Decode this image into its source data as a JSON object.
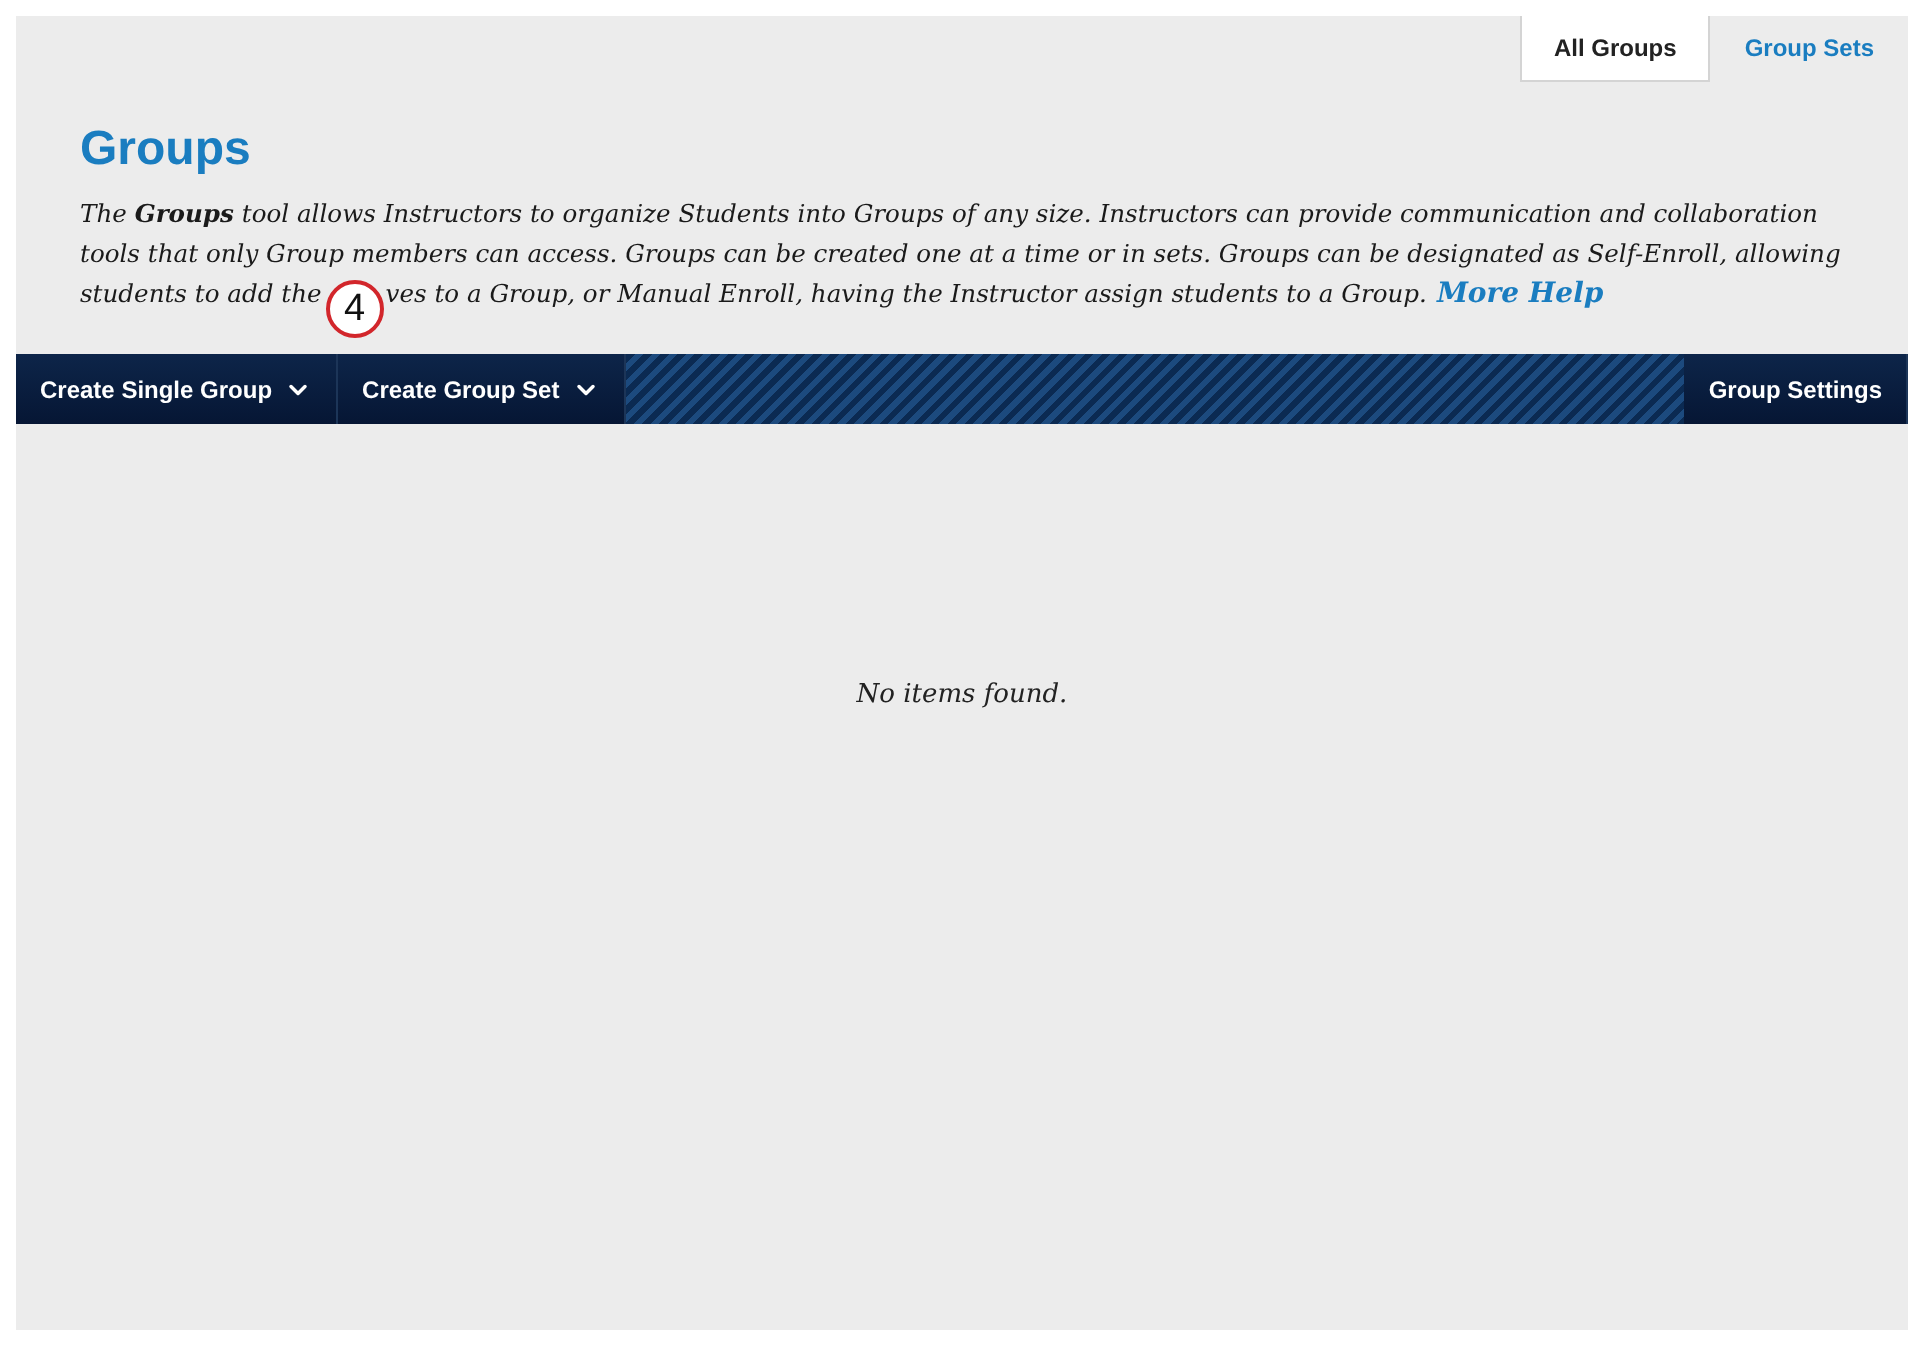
{
  "tabs": [
    {
      "label": "All Groups",
      "selected": true
    },
    {
      "label": "Group Sets",
      "selected": false
    }
  ],
  "title": "Groups",
  "description": {
    "lines": [
      "The **Groups** tool allows Instructors to organize Students into Groups of any size. Instructors can provide communication and collaboration",
      "tools that only Group members can access. Groups can be created one at a time or in sets. Groups can be designated as Self-Enroll, allowing"
    ],
    "last_line_before": "students to add the",
    "last_line_after": "ves to a Group, or Manual Enroll, having the Instructor assign students to a Group.",
    "link": "More Help"
  },
  "callout": "4",
  "toolbar": {
    "menus": [
      {
        "label": "Create Single Group"
      },
      {
        "label": "Create Group Set"
      }
    ],
    "right_button": "Group Settings"
  },
  "empty_message": "No items found."
}
